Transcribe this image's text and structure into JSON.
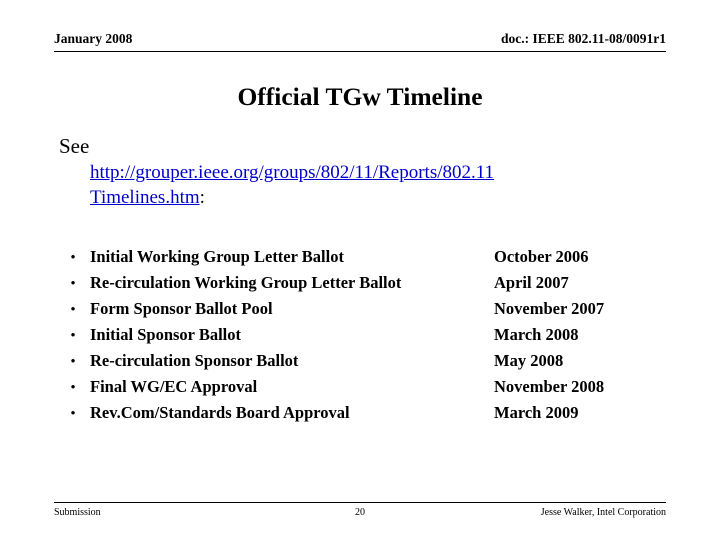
{
  "header": {
    "date": "January 2008",
    "doc_id": "doc.: IEEE 802.11-08/0091r1"
  },
  "title": "Official TGw Timeline",
  "body": {
    "see_label": "See",
    "url_line1": "http://grouper.ieee.org/groups/802/11/Reports/802.11",
    "url_line2": "Timelines.htm",
    "url_trailing": ":"
  },
  "bullets": [
    {
      "marker": "•",
      "text": "Initial Working Group Letter Ballot",
      "date": "October 2006"
    },
    {
      "marker": "•",
      "text": "Re-circulation Working Group Letter Ballot",
      "date": "April 2007"
    },
    {
      "marker": "•",
      "text": "Form Sponsor Ballot Pool",
      "date": "November 2007"
    },
    {
      "marker": "•",
      "text": "Initial Sponsor Ballot",
      "date": "March 2008"
    },
    {
      "marker": "•",
      "text": "Re-circulation Sponsor Ballot",
      "date": "May 2008"
    },
    {
      "marker": "•",
      "text": "Final WG/EC Approval",
      "date": "November 2008"
    },
    {
      "marker": "•",
      "text": "Rev.Com/Standards Board Approval",
      "date": "March 2009"
    }
  ],
  "footer": {
    "left": "Submission",
    "page": "20",
    "right": "Jesse Walker, Intel Corporation"
  },
  "colors": {
    "link": "#0000cc",
    "text": "#000000",
    "background": "#ffffff"
  }
}
